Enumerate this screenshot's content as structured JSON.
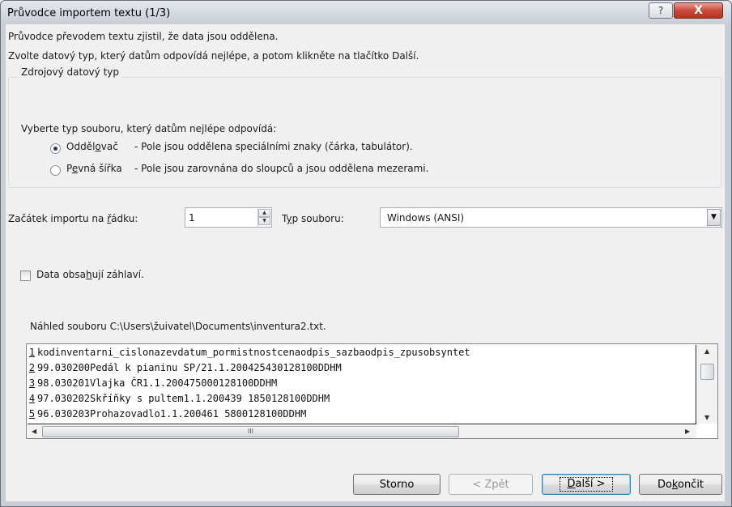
{
  "window": {
    "title": "Průvodce importem textu (1/3)",
    "help_label": "?",
    "close_label": "X"
  },
  "intro": {
    "line1": "Průvodce převodem textu zjistil, že data jsou oddělena.",
    "line2": "Zvolte datový typ, který datům odpovídá nejlépe, a potom klikněte na tlačítko Další."
  },
  "source_type": {
    "legend": "Zdrojový datový typ",
    "prompt": "Vyberte typ souboru, který datům nejlépe odpovídá:",
    "options": [
      {
        "label_a": "Odděl",
        "accel": "o",
        "label_b": "vač",
        "desc": "- Pole jsou oddělena speciálními znaky (čárka, tabulátor).",
        "checked": true
      },
      {
        "label_a": "P",
        "accel": "e",
        "label_b": "vná šířka",
        "desc": "- Pole jsou zarovnána do sloupců a jsou oddělena mezerami.",
        "checked": false
      }
    ]
  },
  "start_row": {
    "label_a": "Začátek importu na ",
    "accel": "ř",
    "label_b": "ádku:",
    "value": "1"
  },
  "file_type": {
    "label_a": "T",
    "accel": "y",
    "label_b": "p souboru:",
    "value": "Windows (ANSI)"
  },
  "headers": {
    "label_a": "Data obsa",
    "accel": "h",
    "label_b": "ují záhlaví.",
    "checked": false
  },
  "preview": {
    "label": "Náhled souboru C:\\Users\\žuivatel\\Documents\\inventura2.txt.",
    "rows": [
      {
        "n": "1",
        "text": "kodinventarni_cislonazevdatum_pormistnostcenaodpis_sazbaodpis_zpusobsyntet"
      },
      {
        "n": "2",
        "text": "99.030200Pedál k pianinu SP/21.1.200425430128100DDHM"
      },
      {
        "n": "3",
        "text": "98.030201Vlajka ČR1.1.200475000128100DDHM"
      },
      {
        "n": "4",
        "text": "97.030202Skříňky s pultem1.1.200439 1850128100DDHM"
      },
      {
        "n": "5",
        "text": "96.030203Prohazovadlo1.1.200461 5800128100DDHM"
      }
    ],
    "hscroll_grip": "III"
  },
  "buttons": {
    "cancel": "Storno",
    "back": "< Zpět",
    "next_a": "",
    "next_accel": "D",
    "next_b": "alší >",
    "finish_a": "Do",
    "finish_accel": "k",
    "finish_b": "ončit"
  }
}
